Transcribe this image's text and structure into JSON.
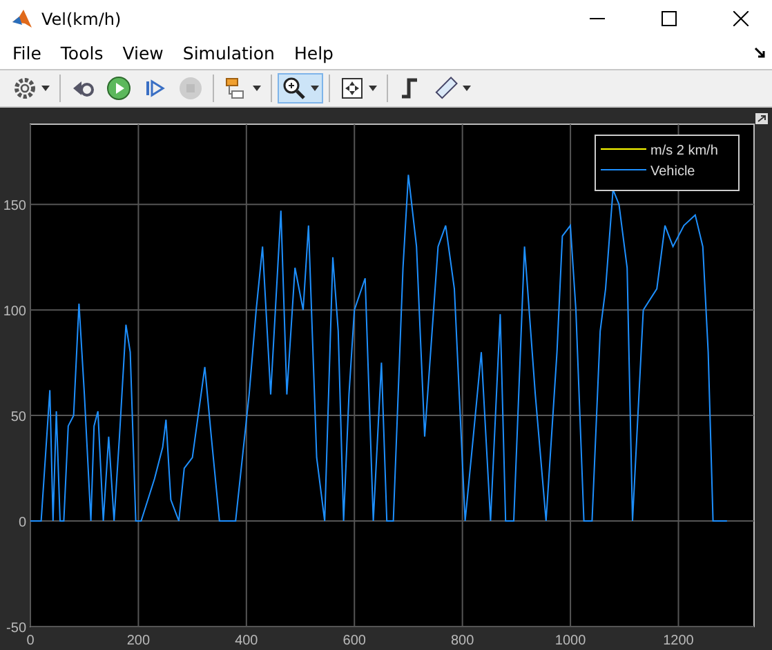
{
  "window": {
    "title": "Vel(km/h)"
  },
  "menu": [
    {
      "label": "File"
    },
    {
      "label": "Tools"
    },
    {
      "label": "View"
    },
    {
      "label": "Simulation"
    },
    {
      "label": "Help"
    }
  ],
  "toolbar": [
    [
      {
        "kind": "settings",
        "dropdown": true,
        "selected": false,
        "disabled": false
      }
    ],
    [
      {
        "kind": "step-back",
        "dropdown": false,
        "selected": false,
        "disabled": false
      },
      {
        "kind": "run",
        "dropdown": false,
        "selected": false,
        "disabled": false
      },
      {
        "kind": "step-forward",
        "dropdown": false,
        "selected": false,
        "disabled": false
      },
      {
        "kind": "stop",
        "dropdown": false,
        "selected": false,
        "disabled": true
      }
    ],
    [
      {
        "kind": "highlight-block",
        "dropdown": true,
        "selected": false,
        "disabled": false
      }
    ],
    [
      {
        "kind": "zoom",
        "dropdown": true,
        "selected": true,
        "disabled": false
      }
    ],
    [
      {
        "kind": "fit",
        "dropdown": true,
        "selected": false,
        "disabled": false
      }
    ],
    [
      {
        "kind": "triggers",
        "dropdown": false,
        "selected": false,
        "disabled": false
      },
      {
        "kind": "measure",
        "dropdown": true,
        "selected": false,
        "disabled": false
      }
    ]
  ],
  "scope": {
    "chart_data": {
      "type": "line",
      "x": [
        0,
        20,
        36,
        42,
        48,
        55,
        62,
        70,
        80,
        90,
        100,
        112,
        118,
        125,
        135,
        145,
        155,
        165,
        177,
        185,
        195,
        205,
        230,
        245,
        251,
        260,
        275,
        285,
        300,
        323,
        335,
        350,
        365,
        380,
        405,
        418,
        430,
        445,
        464,
        475,
        490,
        505,
        515,
        530,
        545,
        560,
        570,
        580,
        590,
        600,
        620,
        635,
        650,
        660,
        672,
        690,
        700,
        715,
        730,
        755,
        769,
        785,
        805,
        820,
        835,
        852,
        870,
        880,
        895,
        915,
        935,
        955,
        975,
        985,
        1000,
        1010,
        1025,
        1040,
        1055,
        1065,
        1079,
        1090,
        1105,
        1115,
        1135,
        1160,
        1175,
        1190,
        1210,
        1231,
        1245,
        1255,
        1264,
        1290
      ],
      "grid": true,
      "legend": true,
      "series": [
        {
          "name": "m/s 2 km/h",
          "color": "#ffff00",
          "values": [
            null,
            null,
            null,
            null,
            null,
            null,
            null,
            null,
            null,
            null,
            null,
            null,
            null,
            null,
            null,
            null,
            null,
            null,
            null,
            null,
            null,
            null,
            null,
            null,
            null,
            null,
            null,
            null,
            null,
            null,
            null,
            null,
            null,
            null,
            null,
            null,
            null,
            null,
            null,
            null,
            null,
            null,
            null,
            null,
            null,
            null,
            null,
            null,
            null,
            null,
            null,
            null,
            null,
            null,
            null,
            null,
            null,
            null,
            null,
            null,
            null,
            null,
            null,
            null,
            null,
            null,
            null,
            null,
            null,
            null,
            null,
            null,
            null,
            null,
            null,
            null,
            null,
            null,
            null,
            null,
            null,
            null,
            null,
            null,
            null,
            null,
            null,
            null,
            null,
            null,
            null,
            null,
            null,
            null
          ]
        },
        {
          "name": "Vehicle",
          "color": "#1e90ff",
          "values": [
            0,
            0,
            62,
            0,
            52,
            0,
            0,
            45,
            50,
            103,
            60,
            0,
            45,
            52,
            0,
            40,
            0,
            40,
            93,
            80,
            0,
            0,
            20,
            35,
            48,
            10,
            0,
            25,
            30,
            73,
            40,
            0,
            0,
            0,
            60,
            100,
            130,
            60,
            147,
            60,
            120,
            100,
            140,
            30,
            0,
            125,
            90,
            0,
            60,
            100,
            115,
            0,
            75,
            0,
            0,
            120,
            164,
            130,
            40,
            130,
            140,
            110,
            0,
            40,
            80,
            0,
            98,
            0,
            0,
            130,
            60,
            0,
            80,
            135,
            140,
            100,
            0,
            0,
            90,
            110,
            157,
            150,
            120,
            0,
            100,
            110,
            140,
            130,
            140,
            145,
            130,
            80,
            0,
            0
          ]
        }
      ],
      "xlim": [
        0,
        1340
      ],
      "ylim": [
        -50,
        188
      ],
      "xticks": [
        0,
        200,
        400,
        600,
        800,
        1000,
        1200
      ],
      "yticks": [
        -50,
        0,
        50,
        100,
        150
      ]
    }
  }
}
